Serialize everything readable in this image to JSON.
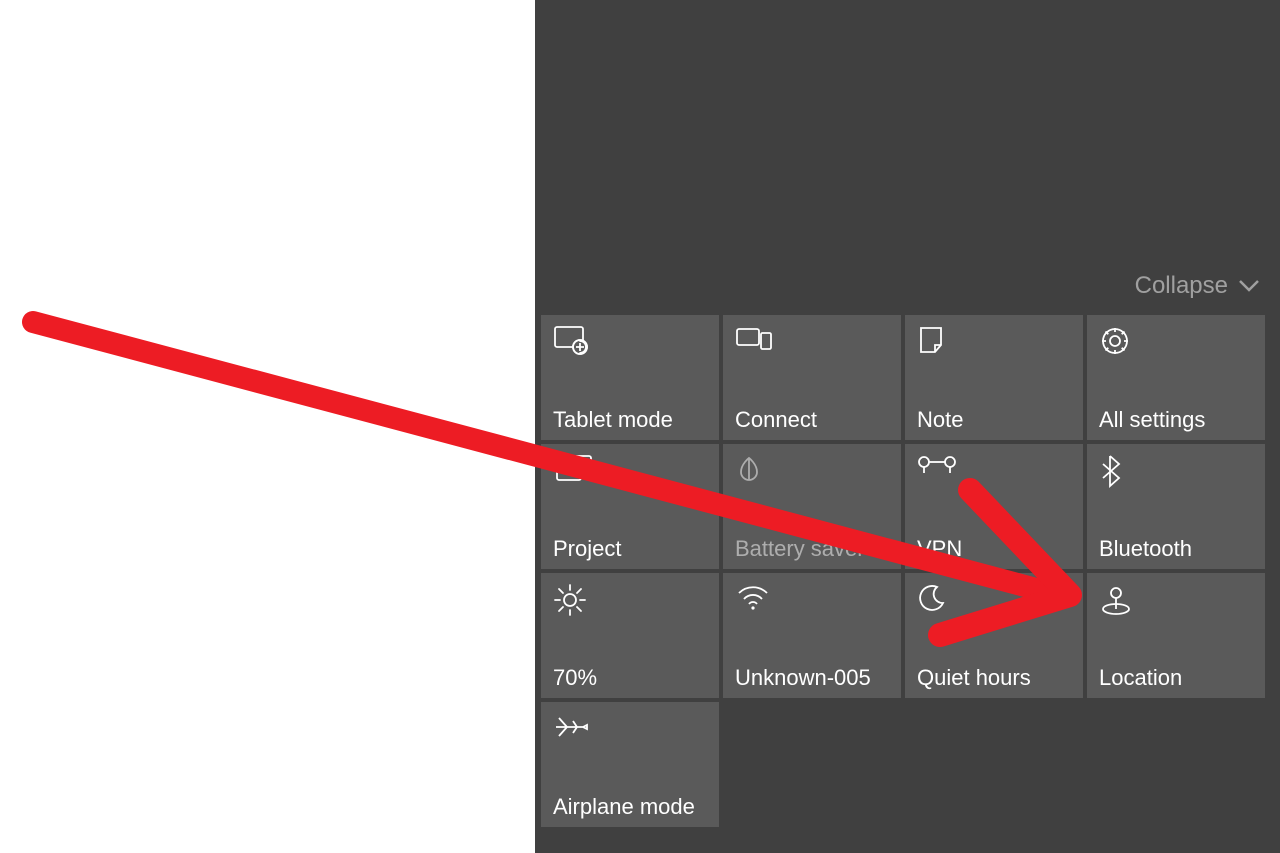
{
  "collapse": {
    "label": "Collapse"
  },
  "tiles": [
    {
      "id": "tablet-mode",
      "label": "Tablet mode",
      "icon": "tablet-mode-icon",
      "disabled": false
    },
    {
      "id": "connect",
      "label": "Connect",
      "icon": "connect-icon",
      "disabled": false
    },
    {
      "id": "note",
      "label": "Note",
      "icon": "note-icon",
      "disabled": false
    },
    {
      "id": "all-settings",
      "label": "All settings",
      "icon": "settings-icon",
      "disabled": false
    },
    {
      "id": "project",
      "label": "Project",
      "icon": "project-icon",
      "disabled": false
    },
    {
      "id": "battery-saver",
      "label": "Battery saver",
      "icon": "battery-saver-icon",
      "disabled": true
    },
    {
      "id": "vpn",
      "label": "VPN",
      "icon": "vpn-icon",
      "disabled": false
    },
    {
      "id": "bluetooth",
      "label": "Bluetooth",
      "icon": "bluetooth-icon",
      "disabled": false
    },
    {
      "id": "brightness",
      "label": "70%",
      "icon": "brightness-icon",
      "disabled": false
    },
    {
      "id": "network",
      "label": "Unknown-005",
      "icon": "wifi-icon",
      "disabled": false
    },
    {
      "id": "quiet-hours",
      "label": "Quiet hours",
      "icon": "quiet-hours-icon",
      "disabled": false
    },
    {
      "id": "location",
      "label": "Location",
      "icon": "location-icon",
      "disabled": false
    },
    {
      "id": "airplane-mode",
      "label": "Airplane mode",
      "icon": "airplane-icon",
      "disabled": false
    }
  ]
}
